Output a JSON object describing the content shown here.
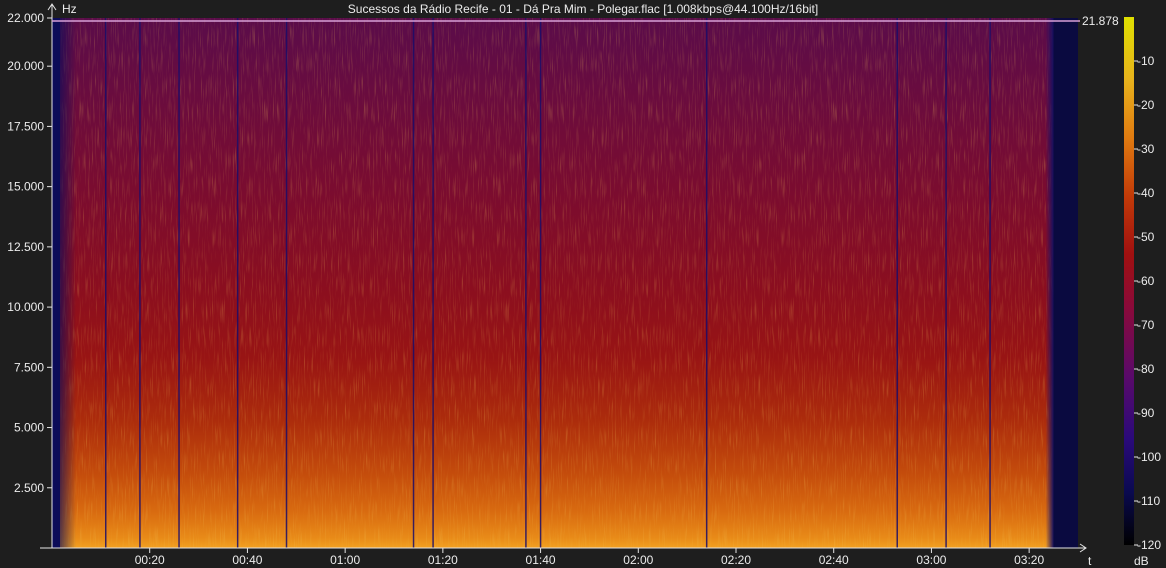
{
  "chart_data": {
    "type": "heatmap",
    "title": "Sucessos da Rádio Recife - 01 - Dá Pra Mim - Polegar.flac [1.008kbps@44.100Hz/16bit]",
    "ylabel": "Hz",
    "xlabel": "t",
    "colorbar_label": "dB",
    "cutoff_marker": {
      "value": 21878,
      "label": "21.878"
    },
    "y_ticks": [
      {
        "value": 22000,
        "label": "22.000"
      },
      {
        "value": 20000,
        "label": "20.000"
      },
      {
        "value": 17500,
        "label": "17.500"
      },
      {
        "value": 15000,
        "label": "15.000"
      },
      {
        "value": 12500,
        "label": "12.500"
      },
      {
        "value": 10000,
        "label": "10.000"
      },
      {
        "value": 7500,
        "label": "7.500"
      },
      {
        "value": 5000,
        "label": "5.000"
      },
      {
        "value": 2500,
        "label": "2.500"
      }
    ],
    "ylim": [
      0,
      22000
    ],
    "x_ticks": [
      {
        "value": 20,
        "label": "00:20"
      },
      {
        "value": 40,
        "label": "00:40"
      },
      {
        "value": 60,
        "label": "01:00"
      },
      {
        "value": 80,
        "label": "01:20"
      },
      {
        "value": 100,
        "label": "01:40"
      },
      {
        "value": 120,
        "label": "02:00"
      },
      {
        "value": 140,
        "label": "02:20"
      },
      {
        "value": 160,
        "label": "02:40"
      },
      {
        "value": 180,
        "label": "03:00"
      },
      {
        "value": 200,
        "label": "03:20"
      }
    ],
    "xlim": [
      0,
      210
    ],
    "audio_end": 205,
    "dark_lines_at": [
      11,
      18,
      26,
      38,
      48,
      74,
      78,
      97,
      100,
      134,
      173,
      183,
      192
    ],
    "colorbar_ticks": [
      {
        "value": -10,
        "label": "-10"
      },
      {
        "value": -20,
        "label": "-20"
      },
      {
        "value": -30,
        "label": "-30"
      },
      {
        "value": -40,
        "label": "-40"
      },
      {
        "value": -50,
        "label": "-50"
      },
      {
        "value": -60,
        "label": "-60"
      },
      {
        "value": -70,
        "label": "-70"
      },
      {
        "value": -80,
        "label": "-80"
      },
      {
        "value": -90,
        "label": "-90"
      },
      {
        "value": -100,
        "label": "-100"
      },
      {
        "value": -110,
        "label": "-110"
      },
      {
        "value": -120,
        "label": "-120"
      }
    ],
    "colorbar_range": [
      -120,
      0
    ],
    "colormap": [
      "#000000",
      "#0a0a50",
      "#2a0a7a",
      "#5a0a6a",
      "#8a0a3a",
      "#a01010",
      "#c23a08",
      "#e07a10",
      "#e8b21c",
      "#e0e000"
    ],
    "grid": false
  }
}
